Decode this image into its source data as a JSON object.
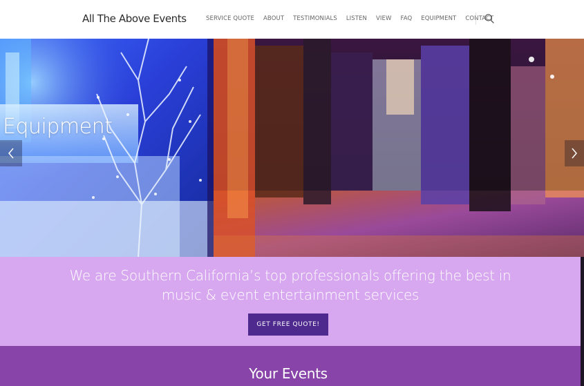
{
  "header": {
    "logo": "All The Above Events",
    "nav": [
      {
        "label": "SERVICE QUOTE"
      },
      {
        "label": "ABOUT"
      },
      {
        "label": "TESTIMONIALS"
      },
      {
        "label": "LISTEN"
      },
      {
        "label": "VIEW"
      },
      {
        "label": "FAQ"
      },
      {
        "label": "EQUIPMENT"
      },
      {
        "label": "CONTACT"
      }
    ],
    "search_icon": "search-icon"
  },
  "hero": {
    "slide_title": "Equipment",
    "prev_icon": "chevron-left-icon",
    "next_icon": "chevron-right-icon"
  },
  "tagline": {
    "line1": "We are Southern California’s top professionals offering the best in",
    "line2": "music & event entertainment services",
    "cta_label": "GET FREE QUOTE!"
  },
  "events": {
    "title": "Your Events"
  },
  "colors": {
    "tagline_band": "#d7a8f0",
    "cta_bg": "#4e2a8e",
    "events_band": "#8844a8"
  }
}
